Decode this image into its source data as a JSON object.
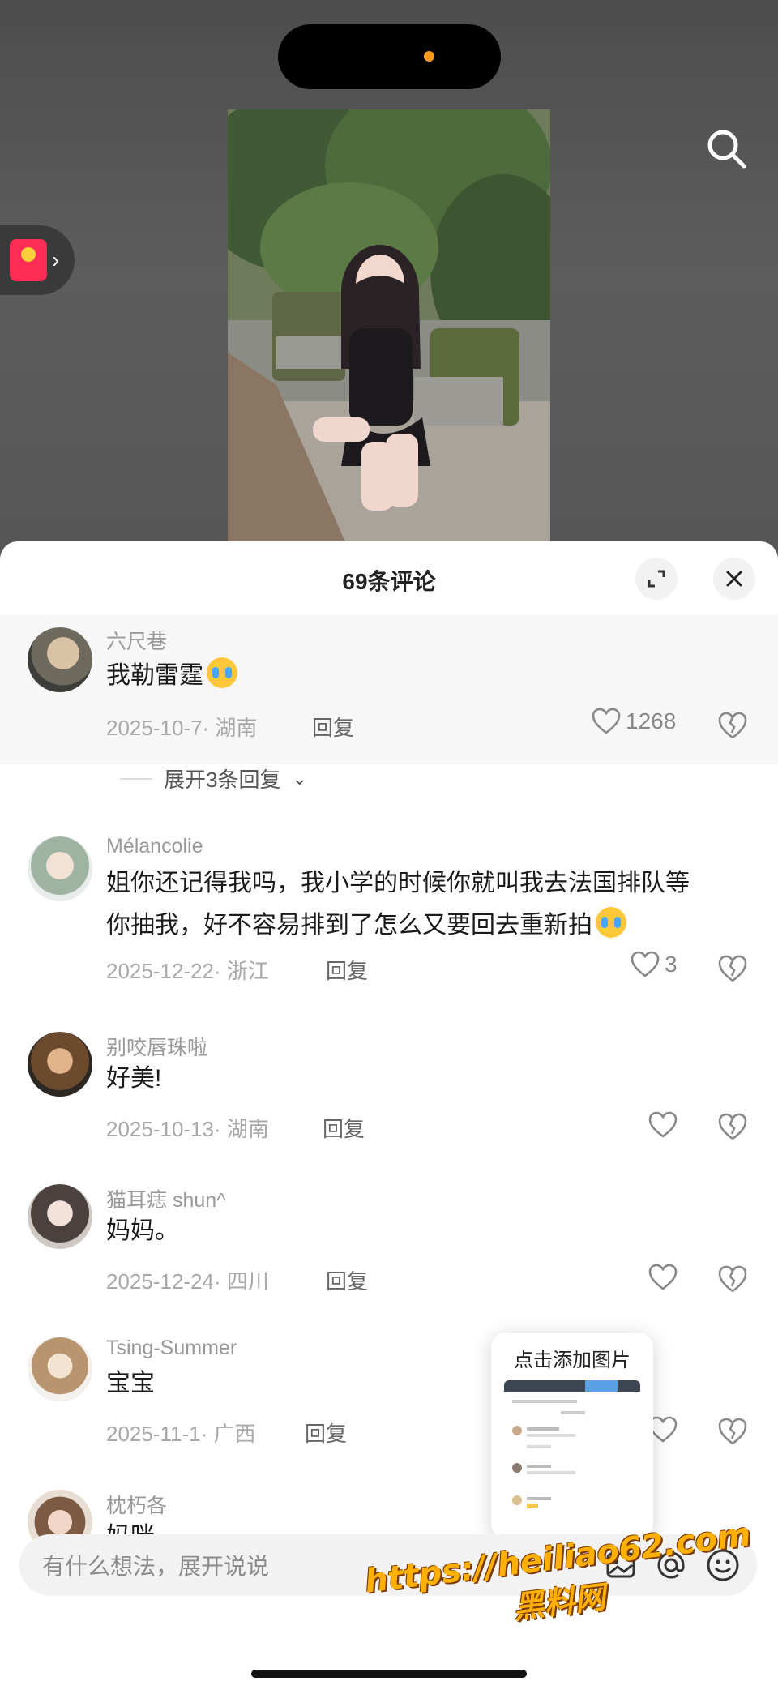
{
  "colors": {
    "accent_orange": "#f39a1f",
    "redpacket": "#ff2d55",
    "sheet_bg": "#ffffff",
    "highlight_bg": "#f7f7f7"
  },
  "top": {
    "search_icon": "search-icon",
    "redpacket_icon": "red-packet-icon"
  },
  "sheet": {
    "title": "69条评论",
    "expand_icon": "expand-icon",
    "close_icon": "close-icon"
  },
  "comments": [
    {
      "user": "六尺巷",
      "text": "我勒雷霆",
      "date_loc": "2025-10-7· 湖南",
      "reply": "回复",
      "likes": "1268",
      "emoji": "crying-face"
    },
    {
      "user": "Mélancolie",
      "text_line1": "姐你还记得我吗，我小学的时候你就叫我去法国排队等",
      "text_line2": "你抽我，好不容易排到了怎么又要回去重新拍",
      "date_loc": "2025-12-22· 浙江",
      "reply": "回复",
      "likes": "3",
      "emoji": "crying-face"
    },
    {
      "user": "别咬唇珠啦",
      "text": "好美!",
      "date_loc": "2025-10-13· 湖南",
      "reply": "回复"
    },
    {
      "user": "猫耳痣 shun^",
      "text": "妈妈。",
      "date_loc": "2025-12-24· 四川",
      "reply": "回复"
    },
    {
      "user": "Tsing-Summer",
      "text": "宝宝",
      "date_loc": "2025-11-1· 广西",
      "reply": "回复"
    },
    {
      "user": "枕朽各",
      "text": "妈咪"
    }
  ],
  "expand_replies": "展开3条回复",
  "popover": {
    "label": "点击添加图片"
  },
  "input": {
    "placeholder": "有什么想法，展开说说"
  },
  "watermark": {
    "url": "https://heiliao62.com",
    "name": "黑料网"
  }
}
